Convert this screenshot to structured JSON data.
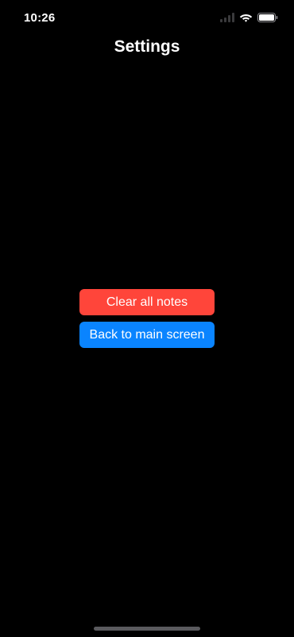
{
  "status_bar": {
    "time": "10:26",
    "icons": [
      "cellular-signal-icon",
      "wifi-icon",
      "battery-icon"
    ]
  },
  "nav": {
    "title": "Settings"
  },
  "actions": {
    "clear_label": "Clear all notes",
    "back_label": "Back to main screen"
  },
  "colors": {
    "background": "#000000",
    "danger": "#ff453a",
    "primary": "#0a84ff"
  }
}
